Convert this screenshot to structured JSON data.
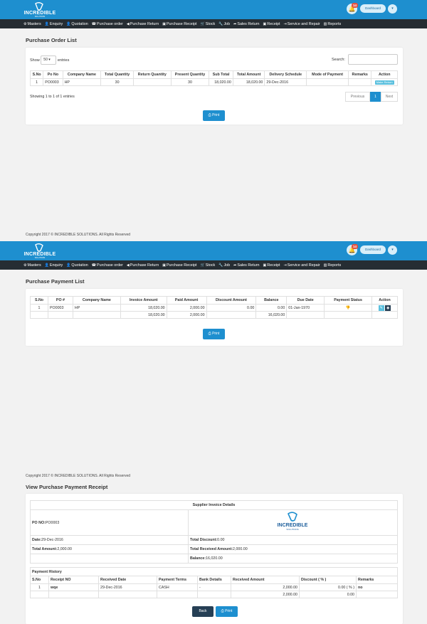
{
  "brand": {
    "name": "INCREDIBLE",
    "tagline": "SOLUTIONS"
  },
  "header": {
    "notification_count": "14",
    "dashboard_label": "Dashboard",
    "dropdown_icon": "caret-down-icon"
  },
  "nav": [
    "Masters",
    "Enquiry",
    "Quotation",
    "Purchase order",
    "Purchase Return",
    "Purchase Receipt",
    "Stock",
    "Job",
    "Sales Return",
    "Receipt",
    "Service and Repair",
    "Reports"
  ],
  "colors": {
    "topbar": "#1e8fcf",
    "nav": "#262d33",
    "accent": "#1e8fcf",
    "back": "#263f55",
    "badge": "#e4513f"
  },
  "copyright": "Copyright 2017 © INCREDIBLE SOLUTIONS. All Rights Reserved",
  "po_list": {
    "title": "Purchase Order List",
    "show_label": "Show",
    "entries_value": "50",
    "entries_label": "entries",
    "search_label": "Search:",
    "columns": [
      "S.No",
      "Po No",
      "Company Name",
      "Total Quantity",
      "Return Quantity",
      "Present Quantity",
      "Sub Total",
      "Total Amount",
      "Delivery Schedule",
      "Mode of Payment",
      "Remarks",
      "Action"
    ],
    "rows": [
      {
        "sno": "1",
        "po": "PO0003",
        "company": "HP",
        "total_qty": "30",
        "return_qty": "",
        "present_qty": "30",
        "sub_total": "18,020.00",
        "total_amount": "18,020.00",
        "delivery": "29-Dec-2016",
        "mode": "",
        "remarks": "",
        "action": "Make Return"
      }
    ],
    "info": "Showing 1 to 1 of 1 entries",
    "pager": {
      "prev": "Previous",
      "page": "1",
      "next": "Next"
    },
    "print_label": "Print"
  },
  "payment_list": {
    "title": "Purchase Payment List",
    "columns": [
      "S.No",
      "PO #",
      "Company Name",
      "Invoice Amount",
      "Paid Amount",
      "Discount Amount",
      "Balance",
      "Due Date",
      "Payment Status",
      "Action"
    ],
    "rows": [
      {
        "sno": "1",
        "po": "PO0003",
        "company": "HP",
        "invoice": "18,020.00",
        "paid": "2,000.00",
        "discount": "0.00",
        "balance": "0.00",
        "due": "01-Jan-1970"
      }
    ],
    "totals": {
      "invoice": "18,020.00",
      "paid": "2,000.00",
      "balance": "16,020.00"
    },
    "print_label": "Print"
  },
  "receipt": {
    "title": "View Purchase Payment Receipt",
    "supplier_header": "Supplier Invoice Details",
    "po_no_label": "PO NO:",
    "po_no": "PO0003",
    "date_label": "Date:",
    "date": "29-Dec-2016",
    "total_discount_label": "Total Discount:",
    "total_discount": "0.00",
    "total_amount_label": "Total Amount:",
    "total_amount": "2,000.00",
    "total_received_label": "Total Received Amount:",
    "total_received": "2,000.00",
    "balance_label": "Balance:",
    "balance": "16,020.00",
    "history_title": "Payment History",
    "columns": [
      "S.No",
      "Receipt NO",
      "Received Date",
      "Payment Terms",
      "Bank Details",
      "Received Amount",
      "Discount ( % )",
      "Remarks"
    ],
    "rows": [
      {
        "sno": "1",
        "receipt_no": "wqe",
        "date": "29-Dec-2016",
        "terms": "CASH",
        "bank": "-",
        "amount": "2,000.00",
        "discount": "0.00 ( % )",
        "remarks": "no"
      }
    ],
    "logo_name": "INCREDIBLE",
    "logo_tagline": "SOLUTIONS",
    "back_label": "Back",
    "print_label": "Print"
  }
}
